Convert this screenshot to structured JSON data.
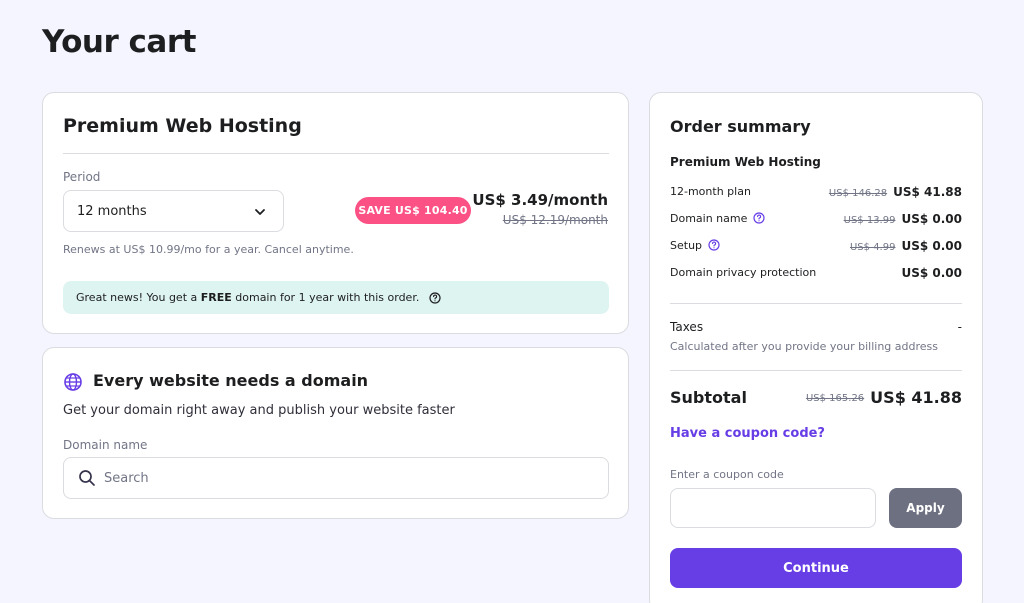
{
  "page": {
    "title": "Your cart"
  },
  "hosting": {
    "title": "Premium Web Hosting",
    "period_label": "Period",
    "period_value": "12 months",
    "save_badge": "SAVE US$ 104.40",
    "price": "US$ 3.49/month",
    "old_price": "US$ 12.19/month",
    "renew_text": "Renews at US$ 10.99/mo for a year. Cancel anytime.",
    "banner_prefix": "Great news! You get a ",
    "banner_bold": "FREE",
    "banner_suffix": " domain for 1 year with this order."
  },
  "domain": {
    "title": "Every website needs a domain",
    "subtitle": "Get your domain right away and publish your website faster",
    "field_label": "Domain name",
    "search_placeholder": "Search"
  },
  "summary": {
    "title": "Order summary",
    "product": "Premium Web Hosting",
    "rows": [
      {
        "label": "12-month plan",
        "old": "US$ 146.28",
        "amount": "US$ 41.88"
      },
      {
        "label": "Domain name",
        "old": "US$ 13.99",
        "amount": "US$ 0.00"
      },
      {
        "label": "Setup",
        "old": "US$ 4.99",
        "amount": "US$ 0.00"
      },
      {
        "label": "Domain privacy protection",
        "old": "",
        "amount": "US$ 0.00"
      }
    ],
    "taxes_label": "Taxes",
    "taxes_value": "-",
    "taxes_note": "Calculated after you provide your billing address",
    "subtotal_label": "Subtotal",
    "subtotal_old": "US$ 165.26",
    "subtotal_amount": "US$ 41.88",
    "coupon_link": "Have a coupon code?",
    "coupon_label": "Enter a coupon code",
    "apply_label": "Apply",
    "continue_label": "Continue"
  },
  "colors": {
    "accent": "#673de6",
    "save_badge": "#fc5185",
    "info_banner": "#def4f0",
    "page_bg": "#f4f5ff"
  },
  "icons": {
    "period_select": "chevron-down-icon",
    "banner_help": "question-circle-icon",
    "domain_header": "globe-icon",
    "search": "search-icon",
    "row_help": "question-circle-icon"
  }
}
